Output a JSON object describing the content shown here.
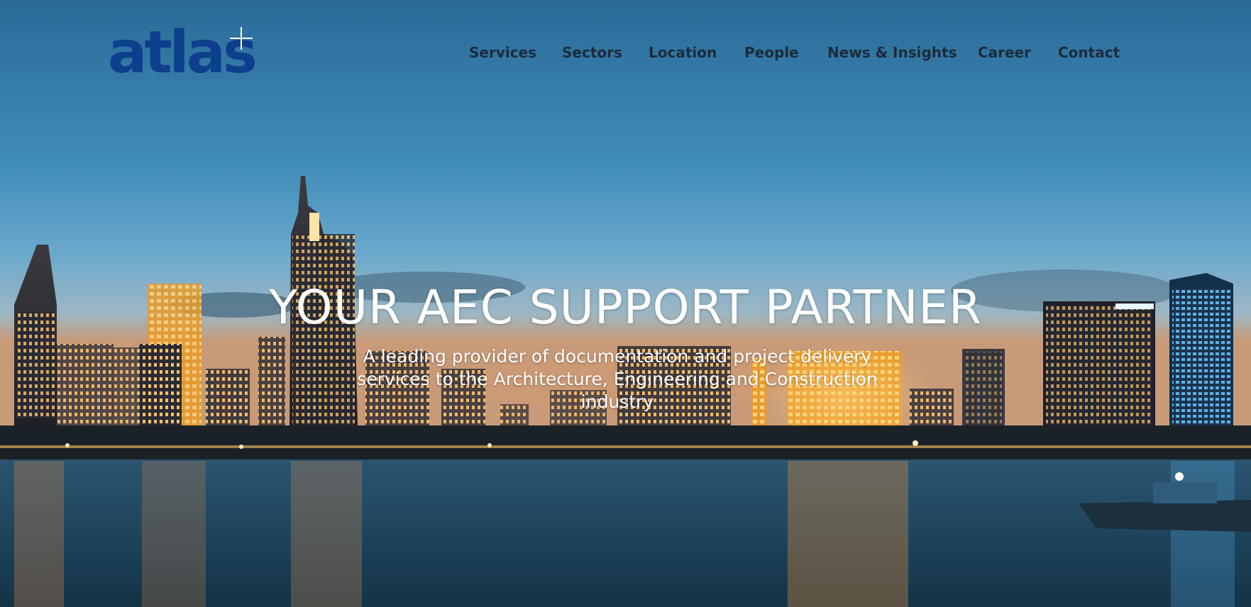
{
  "brand": {
    "logo_text": "atlas",
    "logo_mark": "+",
    "logo_color": "#0c3f8c"
  },
  "nav": {
    "items": [
      {
        "label": "Services"
      },
      {
        "label": "Sectors"
      },
      {
        "label": "Location"
      },
      {
        "label": "People"
      },
      {
        "label": "News & Insights"
      },
      {
        "label": "Career"
      },
      {
        "label": "Contact"
      }
    ]
  },
  "hero": {
    "title": "YOUR AEC SUPPORT PARTNER",
    "subtitle": "A leading provider of documentation and project delivery services to the Architecture, Engineering and Construction industry",
    "image": "city-skyline-night-river-photo"
  },
  "colors": {
    "sky_top": "#2b6f9a",
    "sky_mid": "#4f98c2",
    "water": "#1f4660",
    "city_light": "#ffb24a",
    "nav_text": "#1c2b3a"
  }
}
